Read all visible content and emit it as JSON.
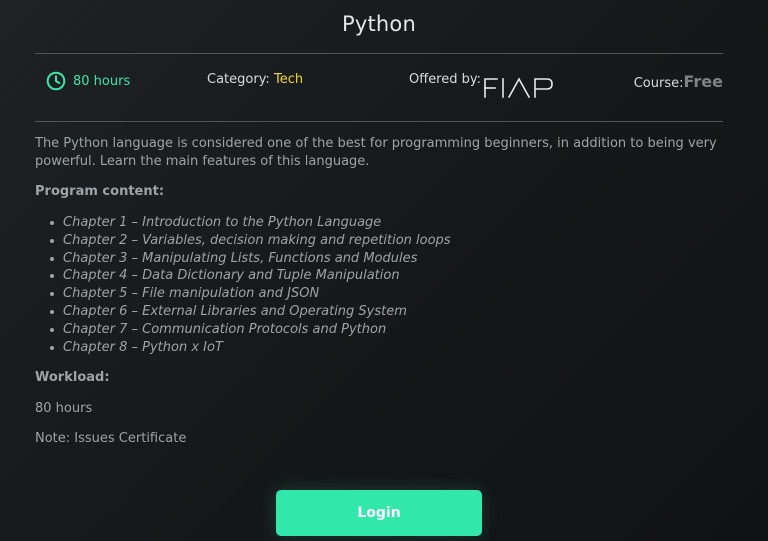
{
  "course": {
    "title": "Python",
    "hours": "80 hours",
    "category_label": "Category:",
    "category_value": "Tech",
    "offered_label": "Offered by:",
    "offered_logo": "FIAP",
    "course_label": "Course:",
    "course_value": "Free"
  },
  "description": "The Python language is considered one of the best for programming beginners, in addition to being very powerful. Learn the main features of this language.",
  "program": {
    "label": "Program content:",
    "chapters": [
      "Chapter 1 – Introduction to the Python Language",
      "Chapter 2 – Variables, decision making and repetition loops",
      "Chapter 3 – Manipulating Lists, Functions and Modules",
      "Chapter 4 – Data Dictionary and Tuple Manipulation",
      "Chapter 5 – File manipulation and JSON",
      "Chapter 6 – External Libraries and Operating System",
      "Chapter 7 – Communication Protocols and Python",
      "Chapter 8 – Python x IoT"
    ]
  },
  "workload": {
    "label": "Workload:",
    "value": "80 hours",
    "note": "Note: Issues Certificate"
  },
  "actions": {
    "login_label": "Login"
  },
  "icons": {
    "hours": "clock-icon"
  },
  "colors": {
    "accent_green": "#31e8aa",
    "category_yellow": "#f0d53c"
  }
}
